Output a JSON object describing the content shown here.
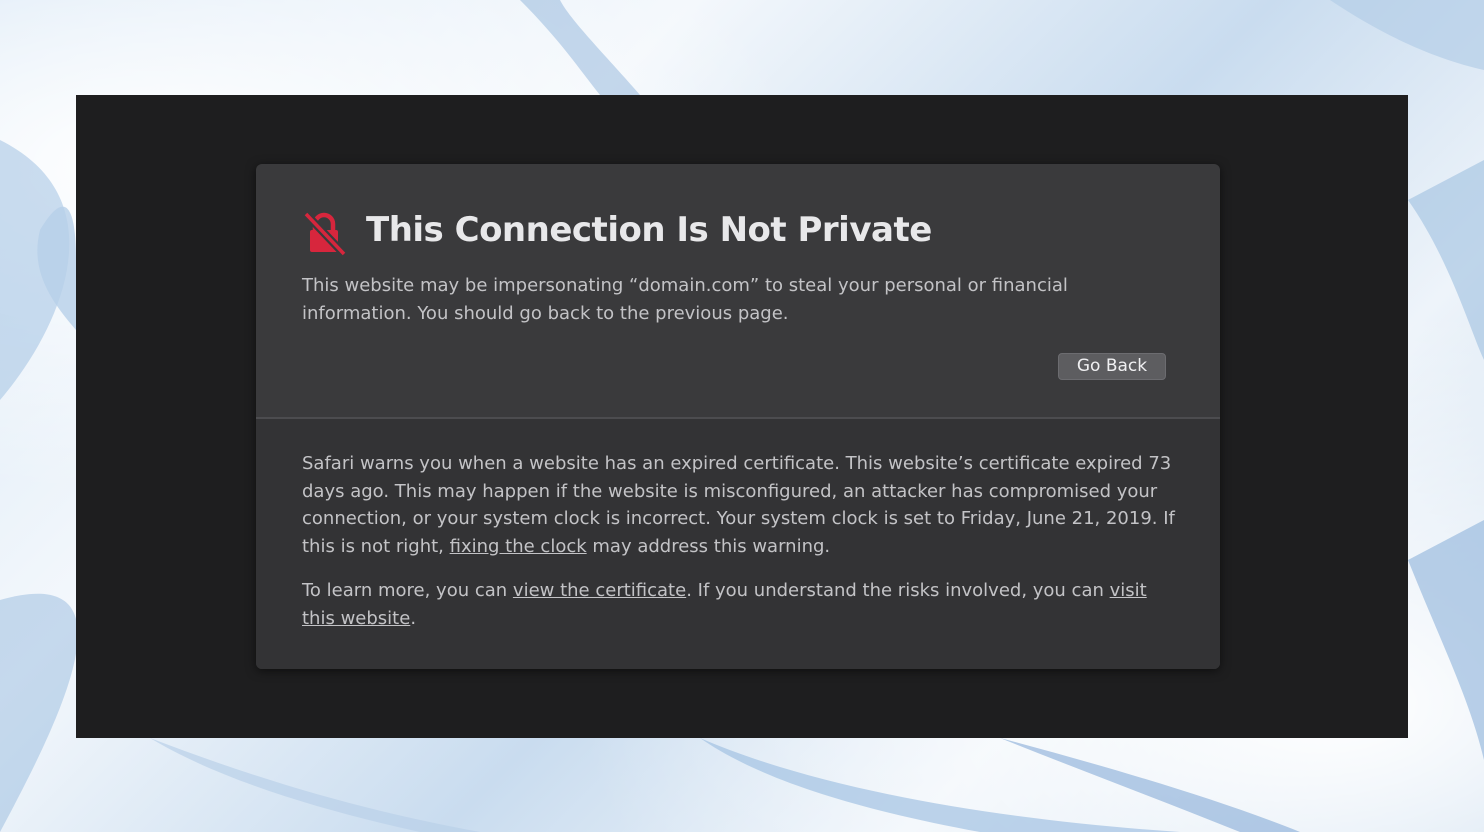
{
  "colors": {
    "accent_red": "#d7263d",
    "card_bg": "#3a3a3c",
    "window_bg": "#1e1e1f",
    "text": "#c3c3c6",
    "title": "#e8e8ea"
  },
  "header": {
    "icon": "lock-slash-icon",
    "title": "This Connection Is Not Private",
    "message": "This website may be impersonating “domain.com” to steal your personal or financial information. You should go back to the previous page."
  },
  "actions": {
    "go_back_label": "Go Back"
  },
  "details": {
    "p1_before": "Safari warns you when a website has an expired certificate. This website’s certificate expired 73 days ago. This may happen if the website is misconfigured, an attacker has compromised your connection, or your system clock is incorrect. Your system clock is set to Friday, June 21, 2019. If this is not right, ",
    "p1_link": "fixing the clock",
    "p1_after": " may address this warning.",
    "p2_before": "To learn more, you can ",
    "p2_link1": "view the certificate",
    "p2_middle": ". If you understand the risks involved, you can ",
    "p2_link2": "visit this website",
    "p2_after": "."
  }
}
